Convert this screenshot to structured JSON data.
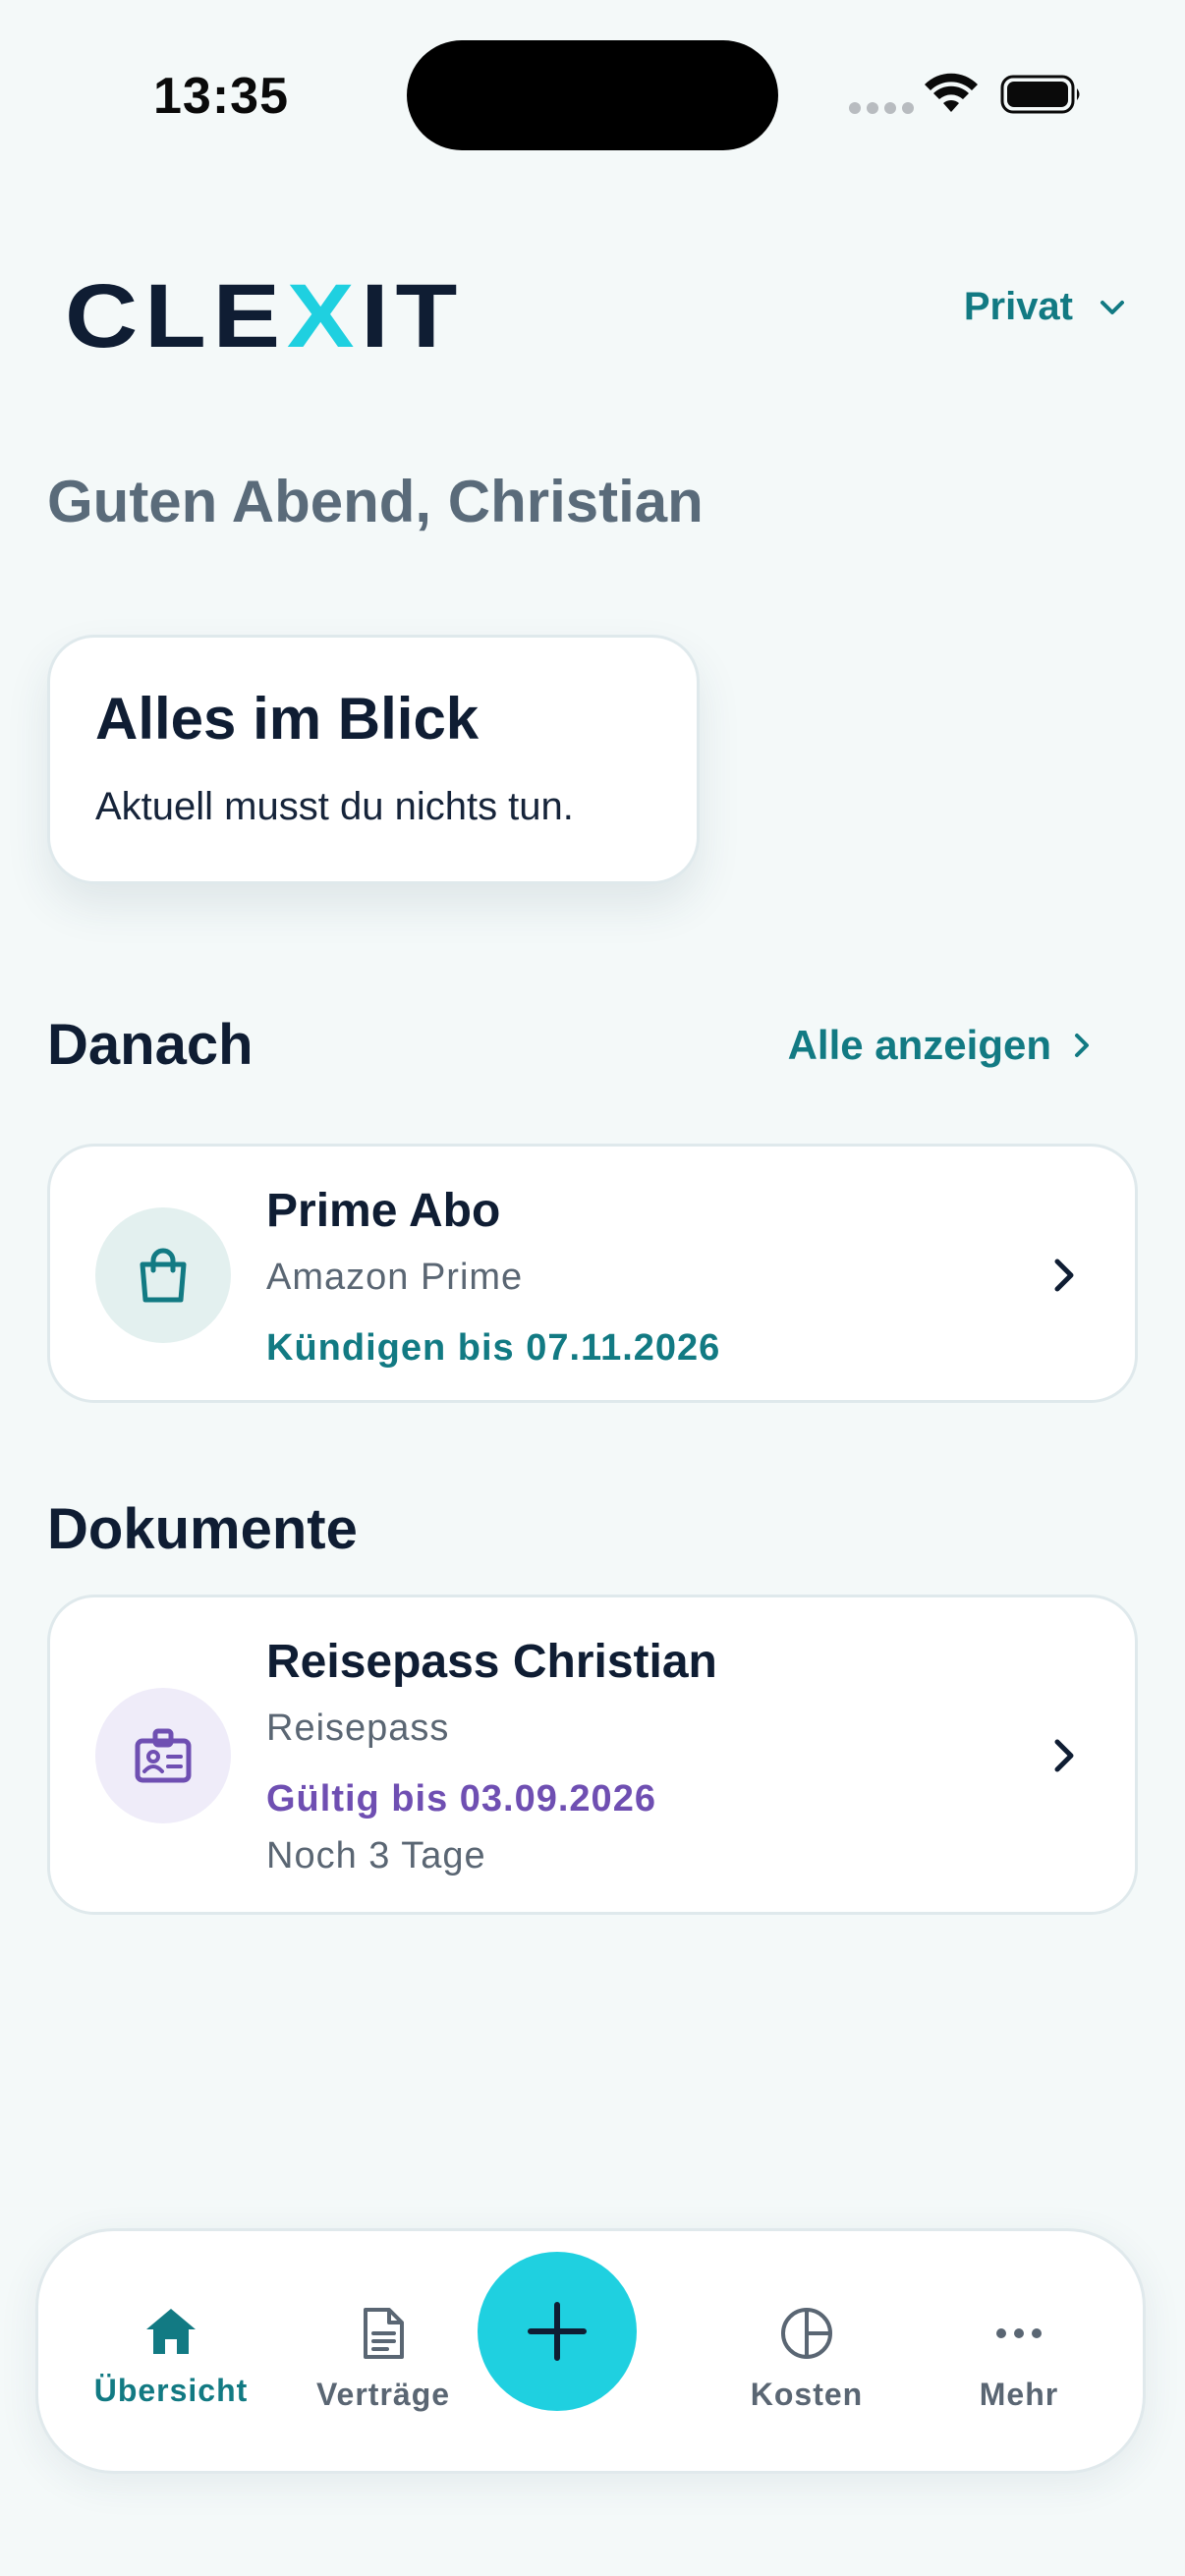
{
  "status_bar": {
    "time": "13:35"
  },
  "header": {
    "logo_text": "CLEXIT",
    "profile_selector": "Privat"
  },
  "greeting": "Guten Abend, Christian",
  "summary_card": {
    "title": "Alles im Blick",
    "subtitle": "Aktuell musst du nichts tun."
  },
  "next_section": {
    "title": "Danach",
    "show_all": "Alle anzeigen",
    "items": [
      {
        "title": "Prime Abo",
        "provider": "Amazon Prime",
        "due": "Kündigen bis 07.11.2026",
        "icon": "shopping-bag-icon",
        "accent": "#127a83"
      }
    ]
  },
  "documents_section": {
    "title": "Dokumente",
    "items": [
      {
        "title": "Reisepass Christian",
        "type": "Reisepass",
        "valid": "Gültig bis 03.09.2026",
        "remaining": "Noch 3 Tage",
        "icon": "id-card-icon",
        "accent": "#6f4fb2"
      }
    ]
  },
  "bottom_nav": {
    "items": [
      {
        "label": "Übersicht",
        "icon": "home-icon",
        "active": true
      },
      {
        "label": "Verträge",
        "icon": "document-icon",
        "active": false
      },
      {
        "label": "Kosten",
        "icon": "pie-chart-icon",
        "active": false
      },
      {
        "label": "Mehr",
        "icon": "more-icon",
        "active": false
      }
    ],
    "fab_icon": "plus-icon"
  },
  "colors": {
    "brand_dark": "#0f1d33",
    "brand_teal": "#127a83",
    "brand_cyan": "#1fd0e0",
    "document_purple": "#6f4fb2",
    "background": "#f4f9f9"
  }
}
